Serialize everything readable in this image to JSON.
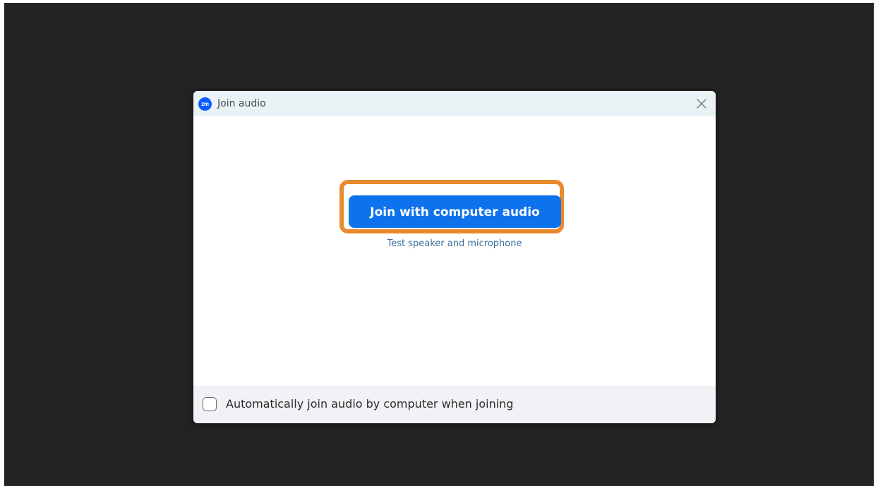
{
  "dialog": {
    "title": "Join audio",
    "app_logo_text": "zm",
    "close_icon": "close-icon"
  },
  "main": {
    "join_button_label": "Join with computer audio",
    "test_link_label": "Test speaker and microphone"
  },
  "footer": {
    "auto_join_label": "Automatically join audio by computer when joining",
    "auto_join_checked": false
  },
  "colors": {
    "background": "#232323",
    "titlebar": "#e9f3f6",
    "primary": "#0e72ed",
    "highlight": "#e98a2c",
    "link": "#3a6f9c",
    "footer": "#f0f2f5"
  }
}
